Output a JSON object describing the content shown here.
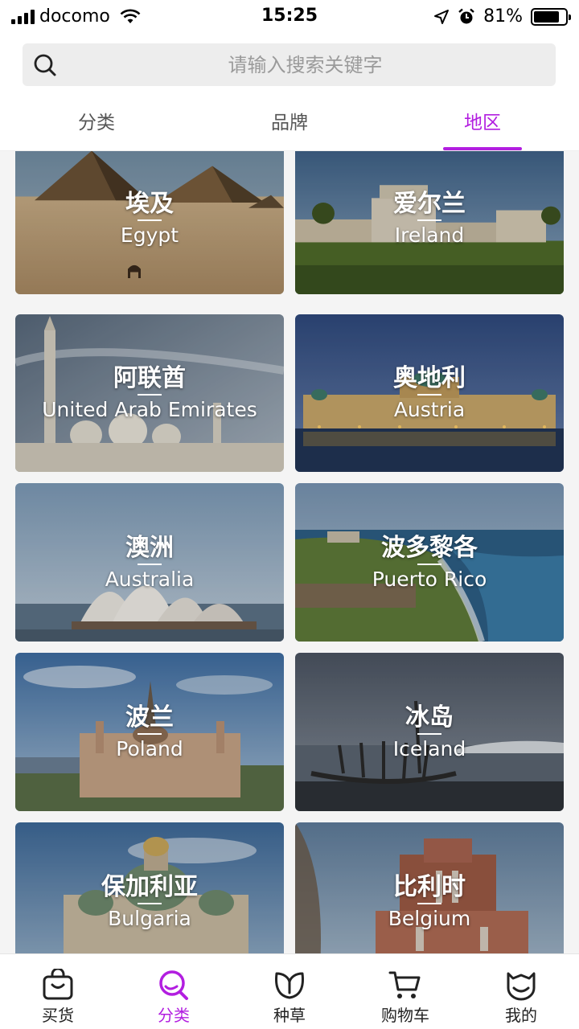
{
  "status_bar": {
    "carrier": "docomo",
    "time": "15:25",
    "battery_percent": "81%",
    "battery_level": 0.81
  },
  "search": {
    "placeholder": "请输入搜索关键字"
  },
  "tabs": [
    {
      "label": "分类",
      "active": false
    },
    {
      "label": "品牌",
      "active": false
    },
    {
      "label": "地区",
      "active": true
    }
  ],
  "regions": [
    {
      "zh": "埃及",
      "en": "Egypt"
    },
    {
      "zh": "爱尔兰",
      "en": "Ireland"
    },
    {
      "zh": "阿联酋",
      "en": "United Arab Emirates"
    },
    {
      "zh": "奥地利",
      "en": "Austria"
    },
    {
      "zh": "澳洲",
      "en": "Australia"
    },
    {
      "zh": "波多黎各",
      "en": "Puerto Rico"
    },
    {
      "zh": "波兰",
      "en": "Poland"
    },
    {
      "zh": "冰岛",
      "en": "Iceland"
    },
    {
      "zh": "保加利亚",
      "en": "Bulgaria"
    },
    {
      "zh": "比利时",
      "en": "Belgium"
    }
  ],
  "bottom_nav": [
    {
      "label": "买货",
      "icon": "shopping-bag-icon",
      "active": false
    },
    {
      "label": "分类",
      "icon": "search-icon",
      "active": true
    },
    {
      "label": "种草",
      "icon": "leaf-icon",
      "active": false
    },
    {
      "label": "购物车",
      "icon": "cart-icon",
      "active": false
    },
    {
      "label": "我的",
      "icon": "face-icon",
      "active": false
    }
  ],
  "colors": {
    "accent": "#b21ee0"
  }
}
